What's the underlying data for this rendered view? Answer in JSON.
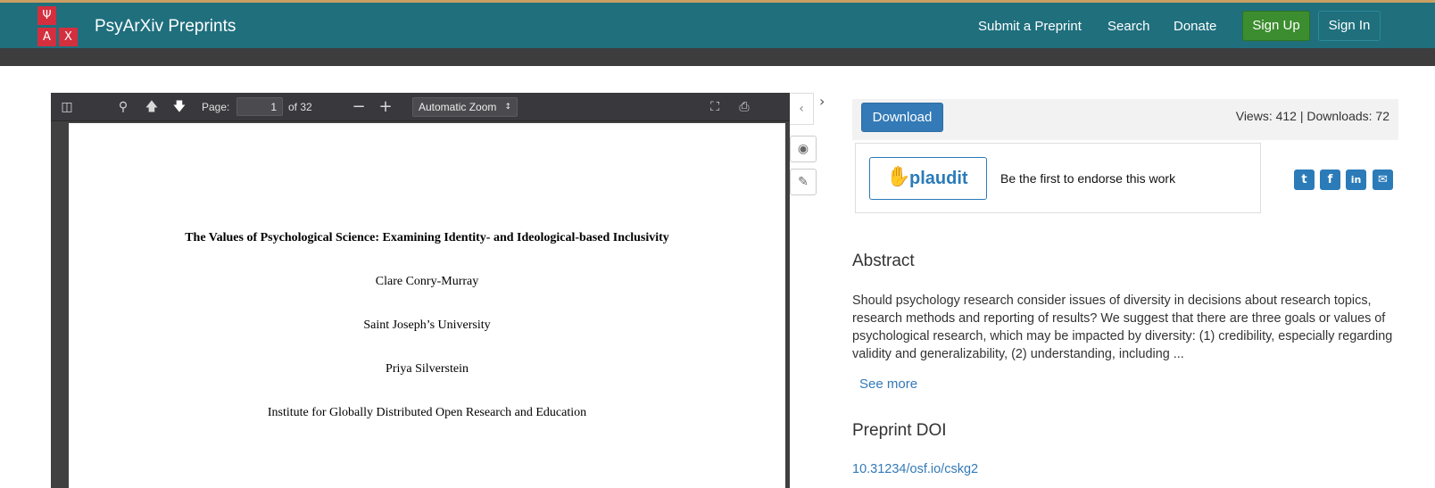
{
  "navbar": {
    "logo_letters": [
      "Ψ",
      "A",
      "X"
    ],
    "brand": "PsyArXiv Preprints",
    "links": [
      "Submit a Preprint",
      "Search",
      "Donate"
    ],
    "sign_up": "Sign Up",
    "sign_in": "Sign In",
    "colors": {
      "bar": "#1f6f7d",
      "logo": "#d32f3f",
      "sign_up": "#3c8d2f"
    }
  },
  "viewer": {
    "page_label": "Page:",
    "page_value": "1",
    "page_of": "of 32",
    "zoom": "Automatic Zoom",
    "icons": [
      "sidebar-toggle-icon",
      "search-icon",
      "previous-page-icon",
      "next-page-icon",
      "zoom-out-icon",
      "zoom-in-icon",
      "fullscreen-icon",
      "print-icon"
    ],
    "pdf": {
      "title": "The Values of Psychological Science: Examining Identity- and Ideological-based Inclusivity",
      "author1": "Clare Conry-Murray",
      "affiliation1": "Saint Joseph’s University",
      "author2": "Priya Silverstein",
      "affiliation2": "Institute for Globally Distributed Open Research and Education"
    }
  },
  "side_tools": [
    "collapse-icon",
    "expand-icon",
    "eye-icon",
    "note-icon"
  ],
  "right": {
    "download": "Download",
    "stats": "Views: 412 | Downloads: 72",
    "plaudit_word": "plaudit",
    "plaudit_message": "Be the first to endorse this work",
    "share_icons": [
      "twitter-icon",
      "facebook-icon",
      "linkedin-icon",
      "email-icon"
    ],
    "abstract_title": "Abstract",
    "abstract_text": "Should psychology research consider issues of diversity in decisions about research topics, research methods and reporting of results? We suggest that there are three goals or values of psychological research, which may be impacted by diversity: (1) credibility, especially regarding validity and generalizability, (2) understanding, including ...",
    "see_more": "See more",
    "doi_title": "Preprint DOI",
    "doi": "10.31234/osf.io/cskg2"
  }
}
